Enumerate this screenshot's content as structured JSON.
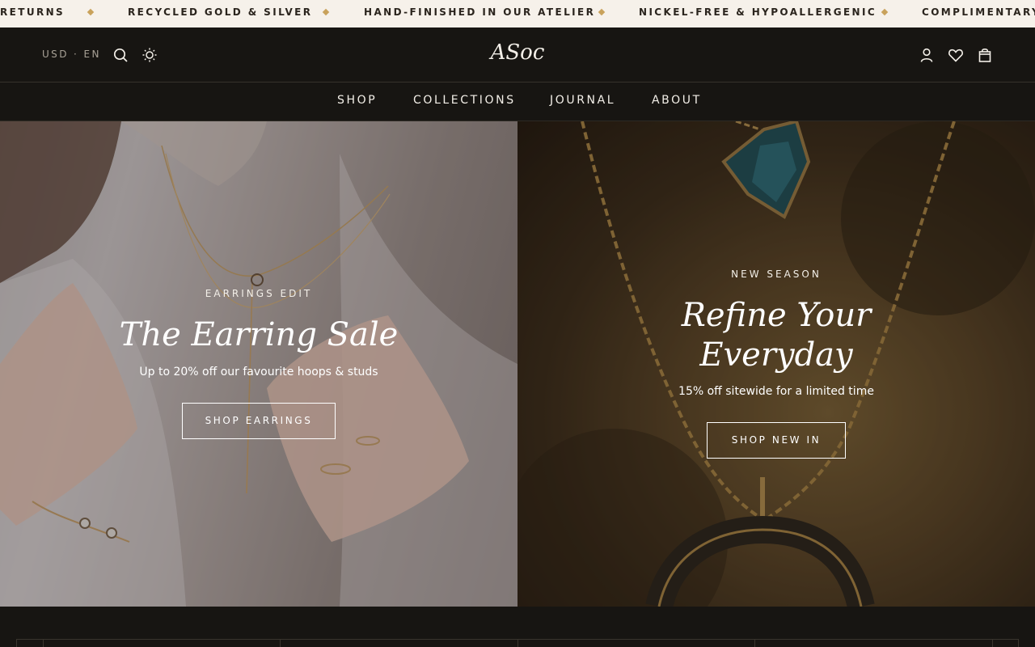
{
  "announcement": {
    "items": [
      "RETURNS",
      "RECYCLED GOLD & SILVER",
      "HAND-FINISHED IN OUR ATELIER",
      "NICKEL-FREE & HYPOALLERGENIC",
      "COMPLIMENTARY"
    ]
  },
  "header": {
    "locale": "USD · EN",
    "logo": "ASoc",
    "icons": [
      "search-icon",
      "sun-icon",
      "account-icon",
      "heart-icon",
      "bag-icon"
    ]
  },
  "nav": {
    "items": [
      "SHOP",
      "COLLECTIONS",
      "JOURNAL",
      "ABOUT"
    ]
  },
  "hero_left": {
    "eyebrow": "EARRINGS EDIT",
    "title": "The Earring Sale",
    "subtitle": "Up to 20% off our favourite hoops & studs",
    "cta": "SHOP EARRINGS"
  },
  "hero_right": {
    "eyebrow": "NEW SEASON",
    "title_line1": "Refine Your",
    "title_line2": "Everyday",
    "subtitle": "15% off sitewide for a limited time",
    "cta": "SHOP NEW IN"
  },
  "colors": {
    "background": "#171512",
    "announcement_bg": "#f6f1ea",
    "accent_gold": "#c9a25b"
  }
}
